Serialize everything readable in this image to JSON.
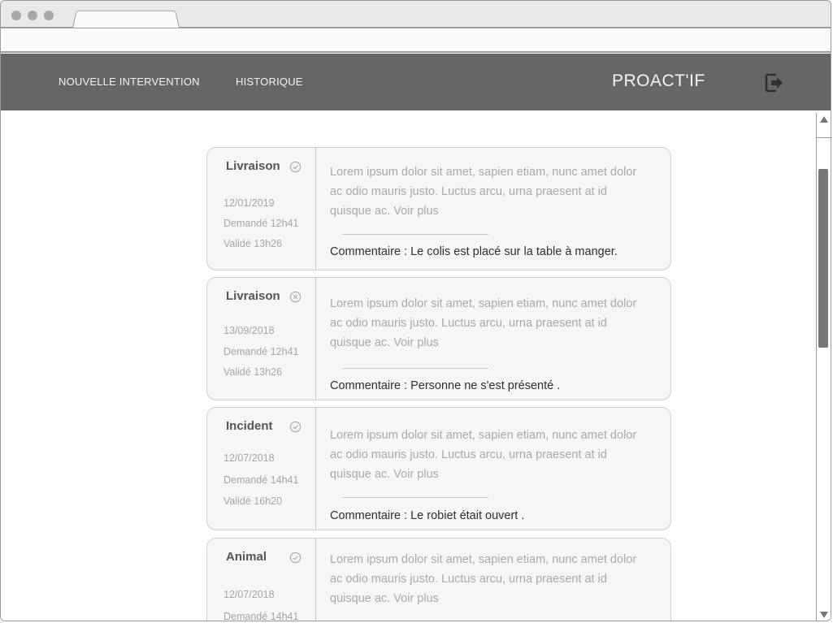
{
  "browser": {
    "tab_title": ""
  },
  "header": {
    "nav": [
      {
        "label": "NOUVELLE INTERVENTION"
      },
      {
        "label": "HISTORIQUE"
      }
    ],
    "brand": "PROACT'IF",
    "logout_icon": "logout-icon"
  },
  "interventions": [
    {
      "type": "Livraison",
      "status": "validated",
      "status_icon": "check-circle-icon",
      "date": "12/01/2019",
      "requested": "Demandé 12h41",
      "validated": "Validé 13h26",
      "description": "Lorem ipsum dolor sit amet, sapien etiam, nunc amet dolor ac odio mauris justo. Luctus arcu, urna praesent at id quisque ac. Voir plus",
      "comment": "Commentaire : Le colis est placé sur la table à manger."
    },
    {
      "type": "Livraison",
      "status": "refused",
      "status_icon": "x-circle-icon",
      "date": "13/09/2018",
      "requested": "Demandé 12h41",
      "validated": "Validé 13h26",
      "description": "Lorem ipsum dolor sit amet, sapien etiam, nunc amet dolor ac odio mauris justo. Luctus arcu, urna praesent at id quisque ac. Voir plus",
      "comment": "Commentaire : Personne ne s'est présenté ."
    },
    {
      "type": "Incident",
      "status": "validated",
      "status_icon": "check-circle-icon",
      "date": "12/07/2018",
      "requested": "Demandé 14h41",
      "validated": "Validé 16h20",
      "description": "Lorem ipsum dolor sit amet, sapien etiam, nunc amet dolor ac odio mauris justo. Luctus arcu, urna praesent at id quisque ac. Voir plus",
      "comment": "Commentaire : Le robiet était ouvert  ."
    },
    {
      "type": "Animal",
      "status": "validated",
      "status_icon": "check-circle-icon",
      "date": "12/07/2018",
      "requested": "Demandé 14h41",
      "validated": "",
      "description": "Lorem ipsum dolor sit amet, sapien etiam, nunc amet dolor ac odio mauris justo. Luctus arcu, urna praesent at id quisque ac. Voir plus",
      "comment": ""
    }
  ],
  "colors": {
    "header_bg": "#666666",
    "card_bg": "#f6f6f6",
    "card_border": "#cfcfcf",
    "muted_text": "#a6a6a6"
  }
}
